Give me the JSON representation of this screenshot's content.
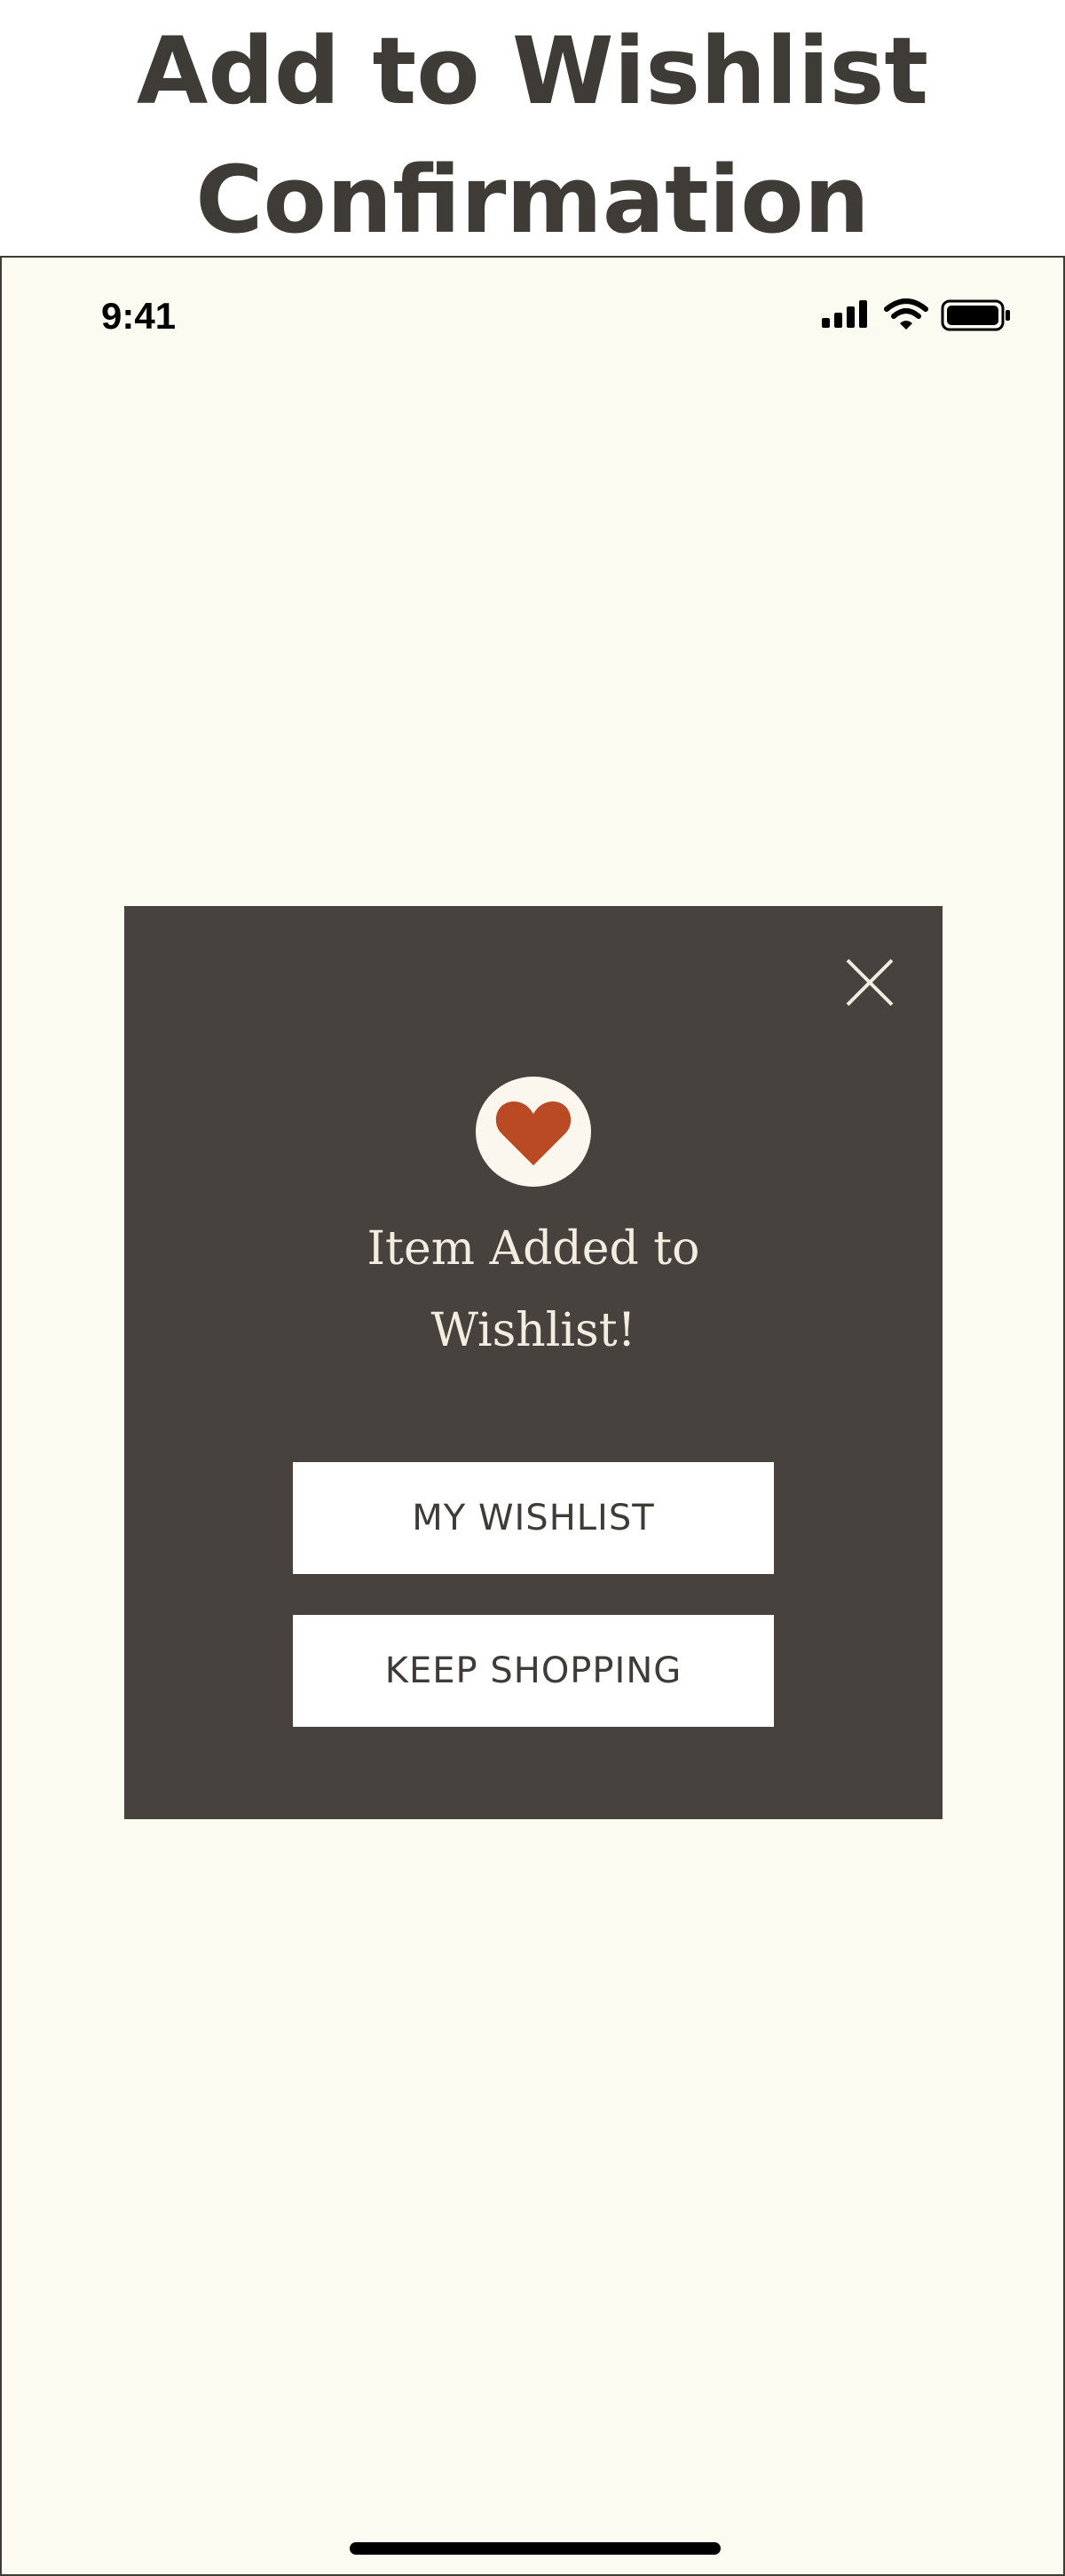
{
  "page": {
    "title": "Add to Wishlist Confirmation"
  },
  "status_bar": {
    "time": "9:41",
    "icons": [
      "signal-icon",
      "wifi-icon",
      "battery-icon"
    ]
  },
  "modal": {
    "close_icon": "close-icon",
    "badge_icon": "heart-icon",
    "message": "Item Added to Wishlist!",
    "primary_button": "MY WISHLIST",
    "secondary_button": "KEEP SHOPPING"
  },
  "colors": {
    "background": "#fbfbf2",
    "modal": "#47423d",
    "accent": "#b94a24",
    "title_text": "#3f3b36"
  }
}
